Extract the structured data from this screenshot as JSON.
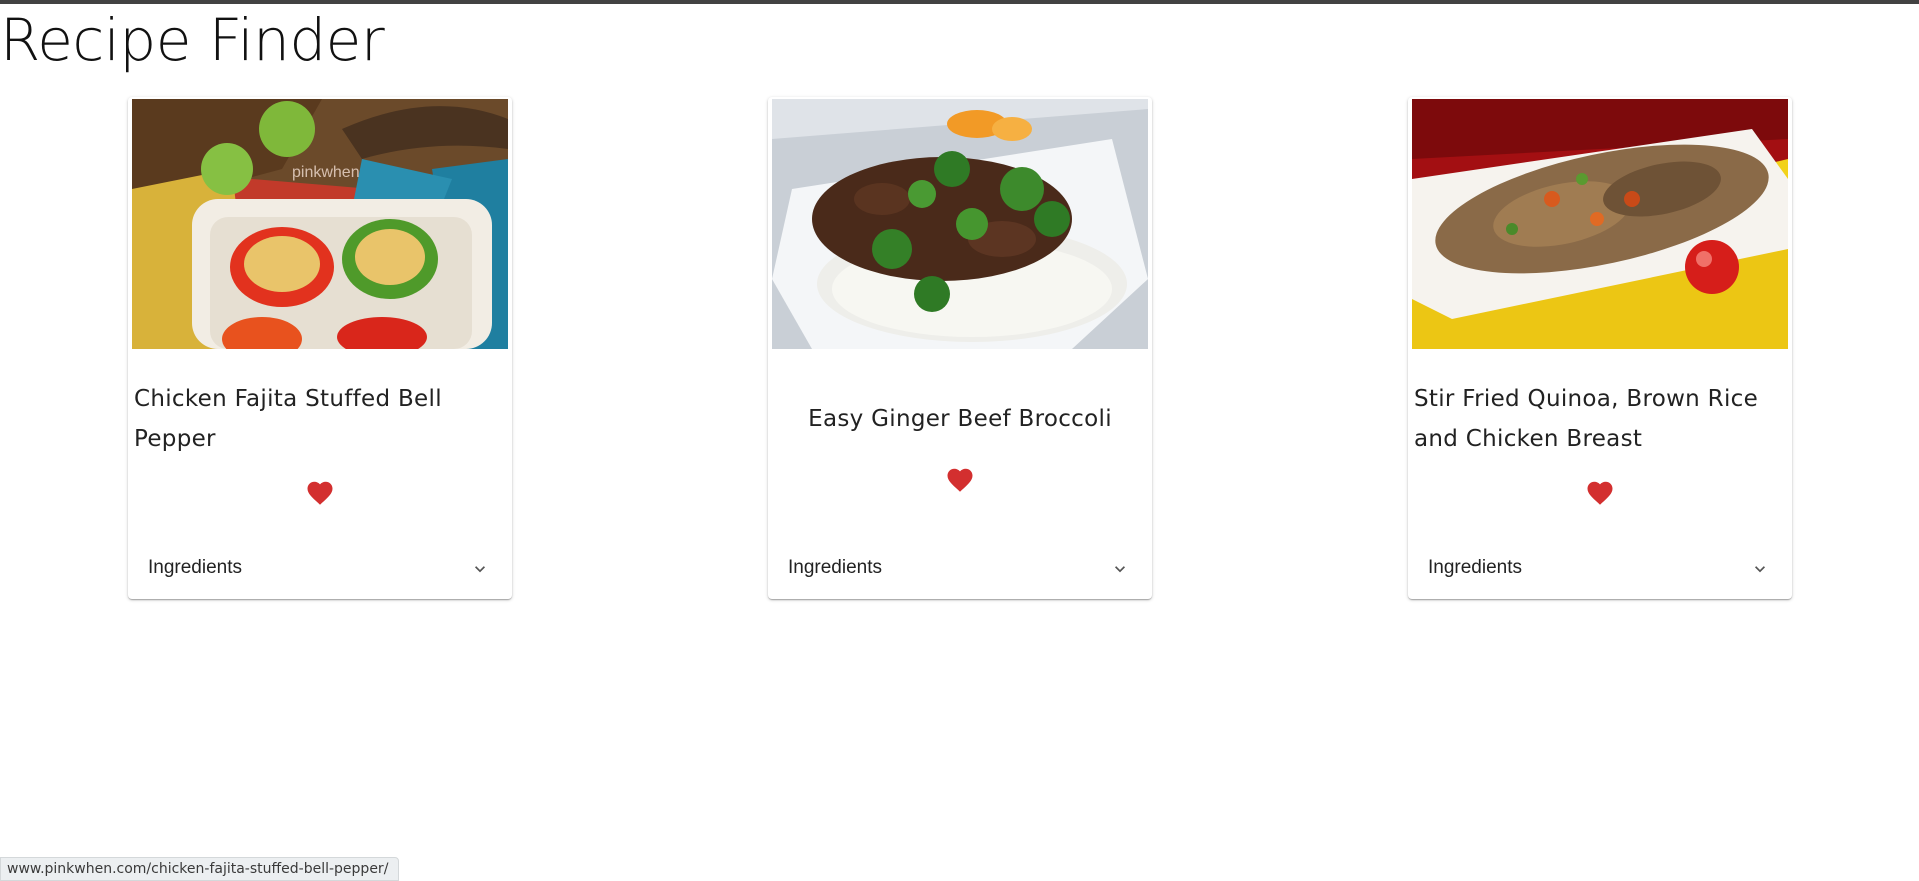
{
  "header": {
    "title": "Recipe Finder"
  },
  "recipes": [
    {
      "title": "Chicken Fajita Stuffed Bell Pepper",
      "image_watermark": "pinkwhen",
      "favorite_icon": "heart-icon",
      "favorited": true,
      "ingredients_label": "Ingredients",
      "expand_icon": "chevron-down-icon"
    },
    {
      "title": "Easy Ginger Beef Broccoli",
      "favorite_icon": "heart-icon",
      "favorited": true,
      "ingredients_label": "Ingredients",
      "expand_icon": "chevron-down-icon"
    },
    {
      "title": "Stir Fried Quinoa, Brown Rice and Chicken Breast",
      "favorite_icon": "heart-icon",
      "favorited": true,
      "ingredients_label": "Ingredients",
      "expand_icon": "chevron-down-icon"
    }
  ],
  "status_bar": {
    "url": "www.pinkwhen.com/chicken-fajita-stuffed-bell-pepper/"
  },
  "colors": {
    "heart": "#d32f2f",
    "chevron": "#555555",
    "top_bar": "#424242"
  }
}
